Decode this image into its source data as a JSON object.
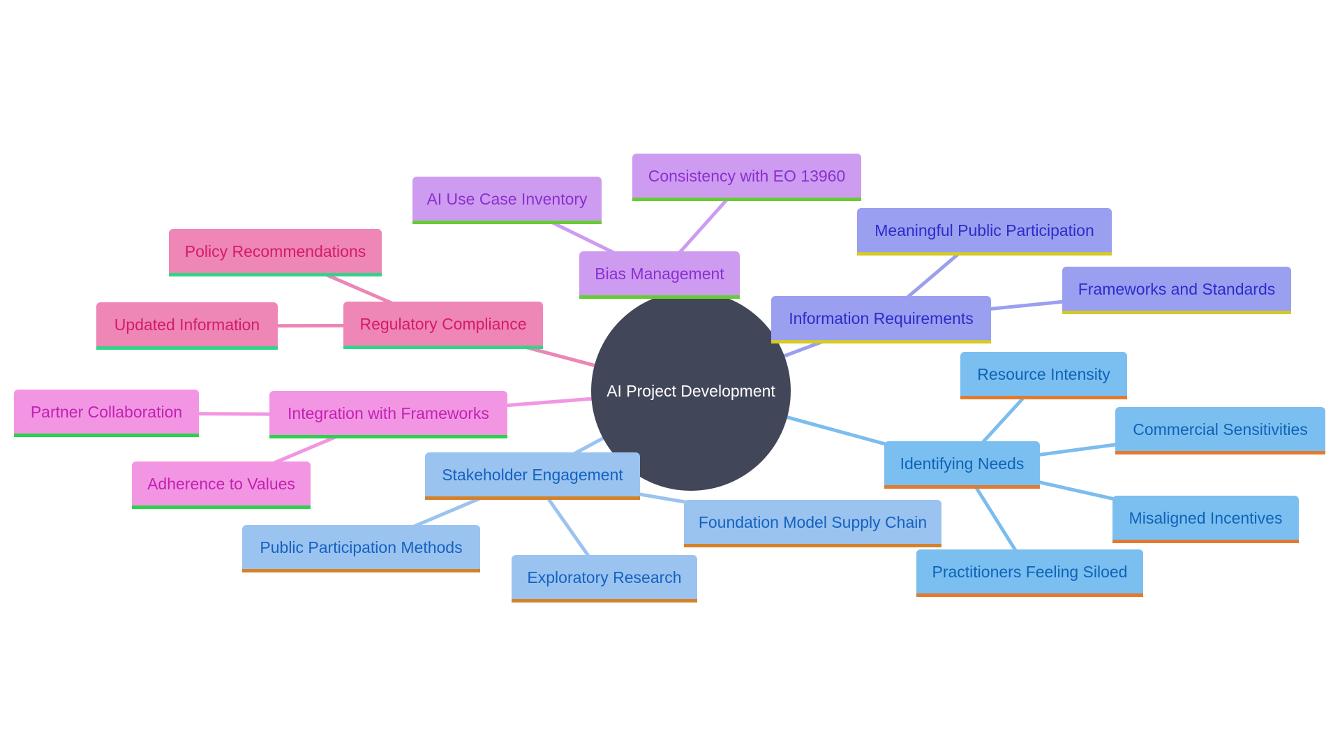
{
  "diagram": {
    "type": "mindmap",
    "root": {
      "id": "root",
      "label": "AI Project Development"
    },
    "branches": [
      {
        "id": "bias",
        "label": "Bias Management",
        "color_fill": "#cd9cf0",
        "color_text": "#8a2fd0",
        "color_accent": "#66cc33",
        "edge_color": "#cd9cf0",
        "children": [
          {
            "id": "bias-1",
            "label": "AI Use Case Inventory"
          },
          {
            "id": "bias-2",
            "label": "Consistency with EO 13960"
          }
        ]
      },
      {
        "id": "reg",
        "label": "Regulatory Compliance",
        "color_fill": "#ee86b6",
        "color_text": "#d41b6a",
        "color_accent": "#33d48a",
        "edge_color": "#ec86b6",
        "children": [
          {
            "id": "reg-1",
            "label": "Policy Recommendations"
          },
          {
            "id": "reg-2",
            "label": "Updated Information"
          }
        ]
      },
      {
        "id": "int",
        "label": "Integration with Frameworks",
        "color_fill": "#f296e3",
        "color_text": "#c320b2",
        "color_accent": "#2ed14d",
        "edge_color": "#f296e3",
        "children": [
          {
            "id": "int-1",
            "label": "Partner Collaboration"
          },
          {
            "id": "int-2",
            "label": "Adherence to Values"
          }
        ]
      },
      {
        "id": "info",
        "label": "Information Requirements",
        "color_fill": "#9a9ff0",
        "color_text": "#2c2cc8",
        "color_accent": "#d3c92a",
        "edge_color": "#9a9fee",
        "children": [
          {
            "id": "info-1",
            "label": "Meaningful Public Participation"
          },
          {
            "id": "info-2",
            "label": "Frameworks and Standards"
          }
        ]
      },
      {
        "id": "need",
        "label": "Identifying Needs",
        "color_fill": "#7bbff0",
        "color_text": "#0e63b8",
        "color_accent": "#e07b30",
        "edge_color": "#7bbdee",
        "children": [
          {
            "id": "need-1",
            "label": "Resource Intensity"
          },
          {
            "id": "need-2",
            "label": "Commercial Sensitivities"
          },
          {
            "id": "need-3",
            "label": "Misaligned Incentives"
          },
          {
            "id": "need-4",
            "label": "Practitioners Feeling Siloed"
          }
        ]
      },
      {
        "id": "stake",
        "label": "Stakeholder Engagement",
        "color_fill": "#9bc3ef",
        "color_text": "#1462c2",
        "color_accent": "#d4822a",
        "edge_color": "#9bc3ef",
        "children": [
          {
            "id": "stake-1",
            "label": "Foundation Model Supply Chain"
          },
          {
            "id": "stake-2",
            "label": "Public Participation Methods"
          },
          {
            "id": "stake-3",
            "label": "Exploratory Research"
          }
        ]
      }
    ],
    "root_color": "#424659"
  }
}
